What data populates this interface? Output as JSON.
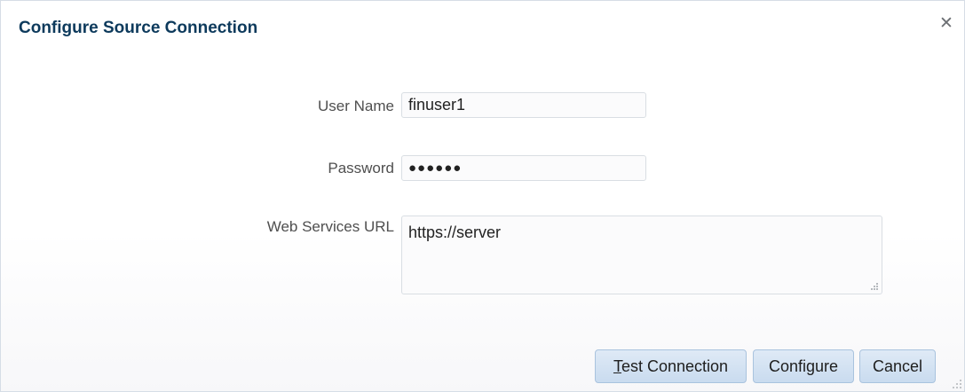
{
  "dialog": {
    "title": "Configure Source Connection",
    "close_icon": "close-icon"
  },
  "form": {
    "username": {
      "label": "User Name",
      "value": "finuser1"
    },
    "password": {
      "label": "Password",
      "value": "●●●●●●"
    },
    "web_services_url": {
      "label": "Web Services URL",
      "value": "https://server"
    }
  },
  "buttons": {
    "test_connection": {
      "mnemonic": "T",
      "rest": "est Connection"
    },
    "configure": "Configure",
    "cancel": "Cancel"
  }
}
